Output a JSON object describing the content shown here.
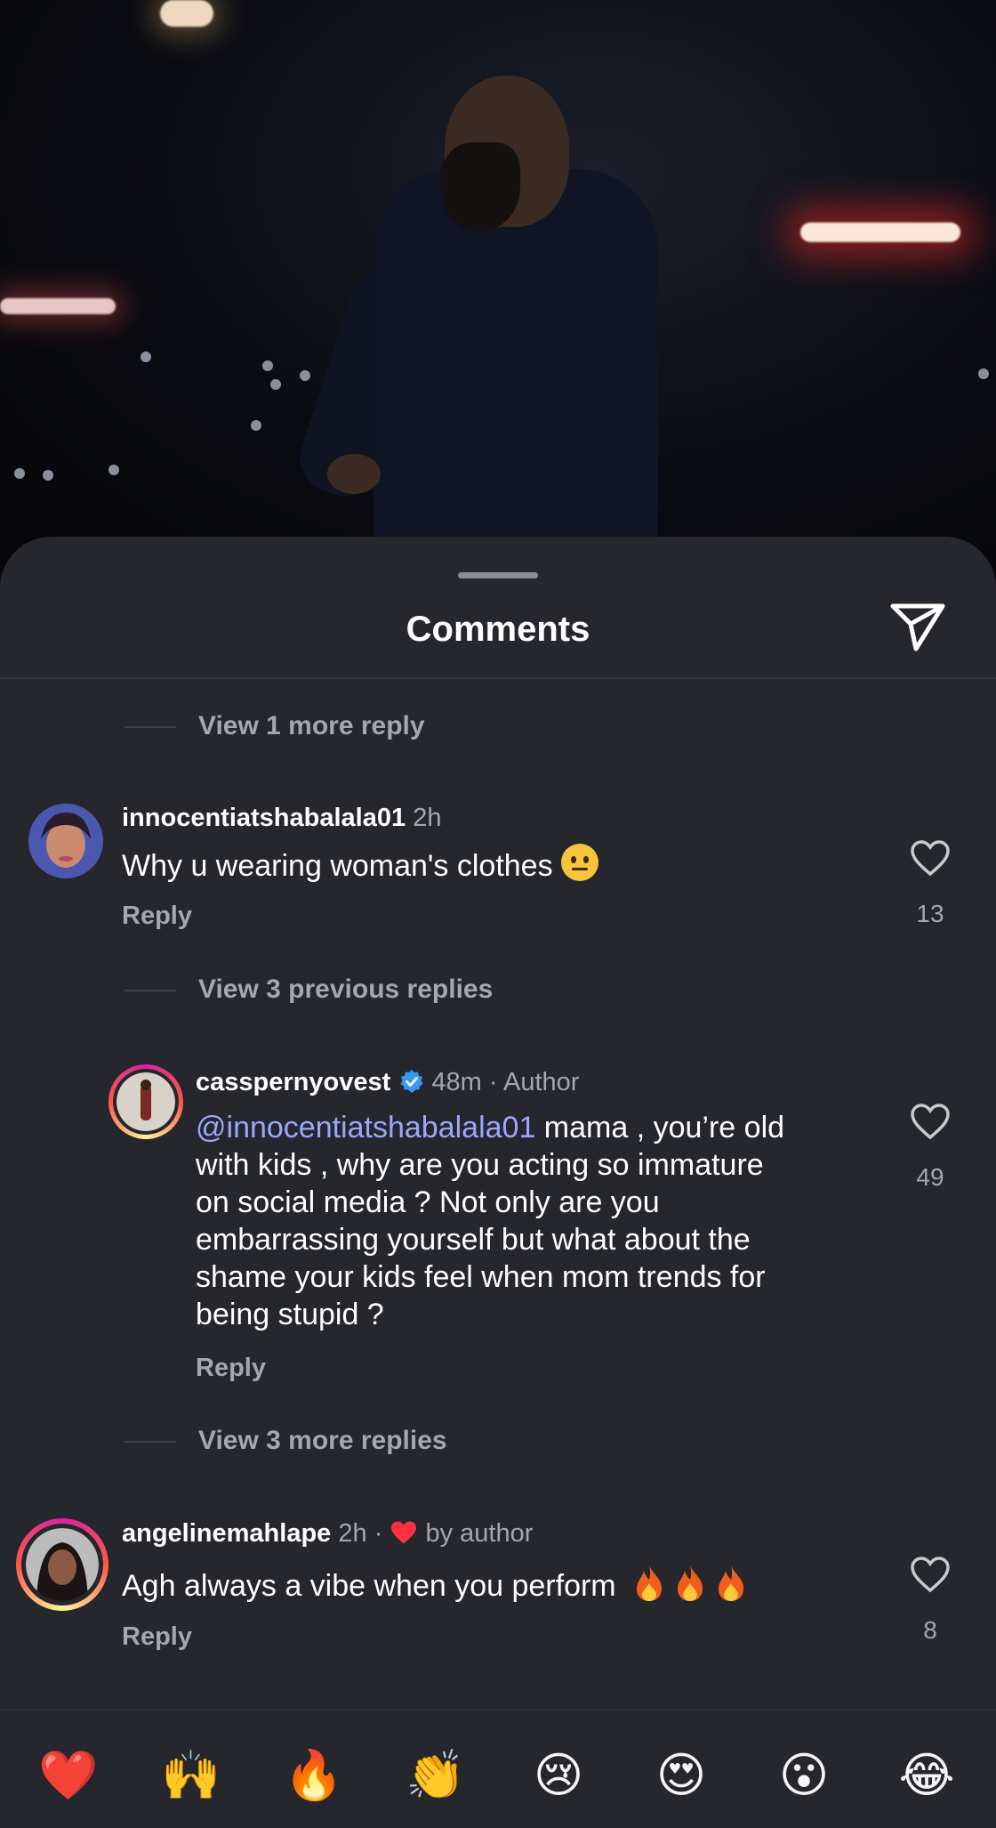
{
  "sheet": {
    "title": "Comments"
  },
  "threads": [
    {
      "view_more_text": "View 1 more reply"
    },
    {
      "view_more_text": "View 3 previous replies"
    },
    {
      "view_more_text": "View 3 more replies"
    }
  ],
  "comments": [
    {
      "username": "innocentiatshabalala01",
      "time": "2h",
      "text": "Why u wearing woman's clothes",
      "emoji": "neutral-face",
      "reply_label": "Reply",
      "likes": "13"
    },
    {
      "username": "casspernyovest",
      "verified": true,
      "time": "48m",
      "author_label": "· Author",
      "mention": "@innocentiatshabalala01",
      "text_lines": [
        " mama , you’re old",
        "with kids , why are you acting so immature",
        "on social media ? Not only are you",
        "embarrassing yourself but what about the",
        "shame your kids feel when mom trends for",
        "being stupid ?"
      ],
      "reply_label": "Reply",
      "likes": "49"
    },
    {
      "username": "angelinemahlape",
      "time": "2h ·",
      "liked_by_author_label": "by author",
      "text": "Agh always a vibe when you perform",
      "emoji": "fire x3",
      "reply_label": "Reply",
      "likes": "8"
    }
  ],
  "quick_reactions": [
    "❤️",
    "🙌",
    "🔥",
    "👏",
    "😢",
    "😍",
    "😮",
    "😂"
  ],
  "colors": {
    "sheet_bg": "#26272c",
    "muted_text": "#a5a7ad",
    "mention": "#9da6ff",
    "verified": "#3897f0",
    "heart_red": "#ff3040"
  }
}
